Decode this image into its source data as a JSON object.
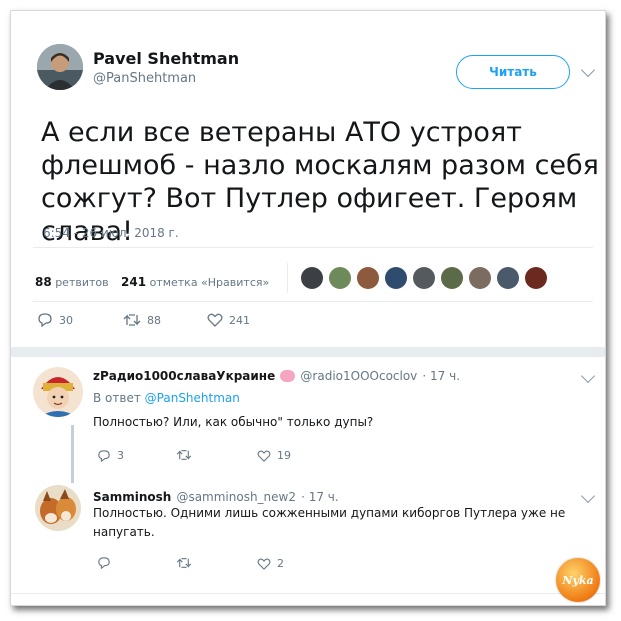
{
  "tweet": {
    "author_name": "Pavel Shehtman",
    "author_handle": "@PanShehtman",
    "follow_label": "Читать",
    "text": "А если все ветераны АТО устроят флешмоб - назло москалям разом себя сожгут? Вот Путлер офигеет. Героям слава!",
    "date": "6:54 - 26 июл. 2018 г.",
    "retweets_count": "88",
    "retweets_label": "ретвитов",
    "likes_count": "241",
    "likes_label": "отметка «Нравится»",
    "actions": {
      "replies": "30",
      "retweets": "88",
      "likes": "241"
    }
  },
  "replies": [
    {
      "author_name": "zРадио1000славаУкраине",
      "author_handle": "@radio1OOOcoclov",
      "time": "· 17 ч.",
      "reply_to_prefix": "В ответ",
      "reply_to_handle": "@PanShehtman",
      "text": "Полностью? Или, как обычно\" только дупы?",
      "actions": {
        "replies": "3",
        "retweets": "",
        "likes": "19"
      }
    },
    {
      "author_name": "Samminosh",
      "author_handle": "@samminosh_new2",
      "time": "· 17 ч.",
      "text": "Полностью. Одними лишь сожженными дупами киборгов Путлера уже не напугать.",
      "actions": {
        "replies": "",
        "retweets": "",
        "likes": "2"
      }
    }
  ],
  "watermark": "Nyka",
  "colors": {
    "accent": "#1da1f2",
    "secondary_text": "#657786",
    "divider": "#e6ecf0"
  },
  "icons": [
    "chevron-down-icon",
    "reply-icon",
    "retweet-icon",
    "like-icon",
    "pig-emoji-icon"
  ]
}
